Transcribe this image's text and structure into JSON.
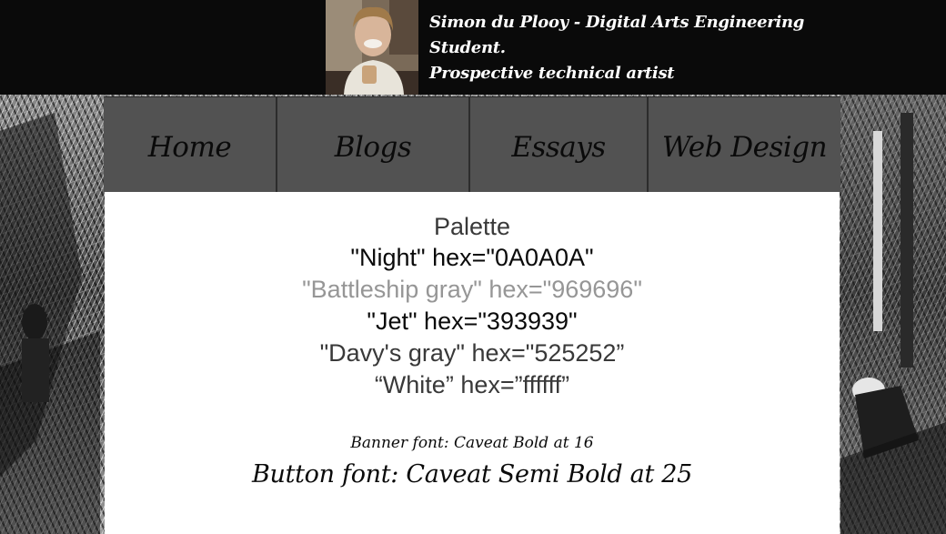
{
  "banner": {
    "line1": "Simon du Plooy - Digital Arts Engineering",
    "line2": "Student.",
    "line3": "Prospective technical artist"
  },
  "nav": {
    "items": [
      {
        "label": "Home"
      },
      {
        "label": "Blogs"
      },
      {
        "label": "Essays"
      },
      {
        "label": "Web Design"
      }
    ]
  },
  "content": {
    "palette_title": "Palette",
    "palette": [
      {
        "text": "\"Night\" hex=\"0A0A0A\"",
        "color": "#0a0a0a"
      },
      {
        "text": "\"Battleship gray\" hex=\"969696\"",
        "color": "#969696"
      },
      {
        "text": "\"Jet\" hex=\"393939\"",
        "color": "#393939"
      },
      {
        "text": "\"Davy's gray\" hex=\"525252”",
        "color": "#525252"
      },
      {
        "text": "“White” hex=”ffffff”",
        "color": "#ffffff"
      }
    ],
    "banner_font": "Banner font: Caveat Bold at 16",
    "button_font": "Button font: Caveat Semi Bold at 25"
  },
  "colors": {
    "banner_bg": "#0a0a0a",
    "nav_bg": "#525252",
    "content_bg": "#ffffff"
  }
}
